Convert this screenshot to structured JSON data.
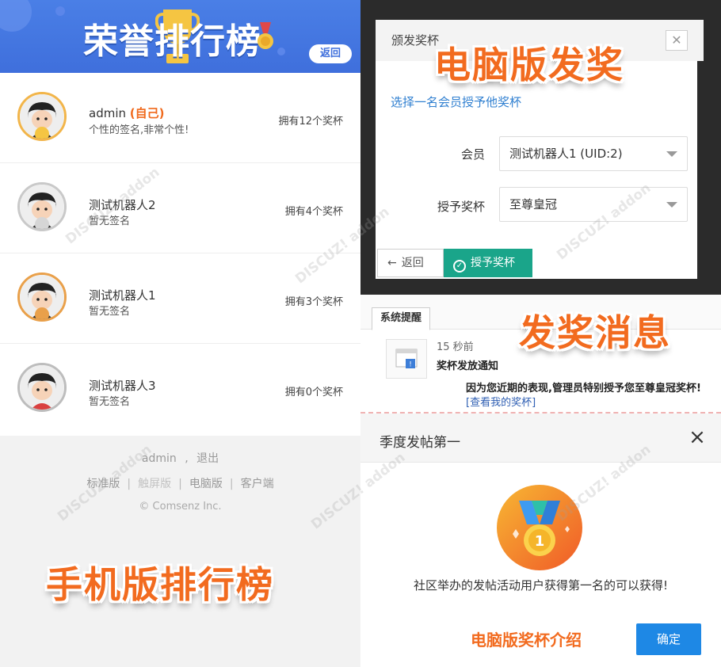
{
  "mobile_rank": {
    "title": "荣誉排行榜",
    "back_label": "返回",
    "rows": [
      {
        "name": "admin",
        "self_tag": "(自己)",
        "signature": "个性的签名,非常个性!",
        "count": "拥有12个奖杯",
        "badge": "1"
      },
      {
        "name": "测试机器人2",
        "signature": "暂无签名",
        "count": "拥有4个奖杯",
        "badge": "2"
      },
      {
        "name": "测试机器人1",
        "signature": "暂无签名",
        "count": "拥有3个奖杯",
        "badge": "3"
      },
      {
        "name": "测试机器人3",
        "signature": "暂无签名",
        "count": "拥有0个奖杯"
      }
    ],
    "footer": {
      "user": "admin",
      "logout": "退出",
      "links": [
        "标准版",
        "触屏版",
        "电脑版",
        "客户端"
      ],
      "copyright": "© Comsenz Inc."
    },
    "caption": "手机版排行榜"
  },
  "award_dialog": {
    "title": "颁发奖杯",
    "caption": "电脑版发奖",
    "link_text": "选择一名会员授予他奖杯",
    "member_label": "会员",
    "member_value": "测试机器人1 (UID:2)",
    "award_label": "授予奖杯",
    "award_value": "至尊皇冠",
    "back_label": "返回",
    "grant_label": "授予奖杯"
  },
  "notice": {
    "tab": "系统提醒",
    "caption": "发奖消息",
    "time": "15 秒前",
    "title": "奖杯发放通知",
    "body": "因为您近期的表现,管理员特别授予您至尊皇冠奖杯!",
    "link": "[查看我的奖杯]"
  },
  "intro": {
    "title": "季度发帖第一",
    "medal_number": "1",
    "description": "社区举办的发帖活动用户获得第一名的可以获得!",
    "caption": "电脑版奖杯介绍",
    "confirm_label": "确定"
  },
  "colors": {
    "header_blue": "#3f6fdc",
    "caption_orange": "#f26b1f",
    "grant_green": "#1aa58a",
    "confirm_blue": "#1e88e5",
    "link_blue": "#2f7fd0"
  }
}
